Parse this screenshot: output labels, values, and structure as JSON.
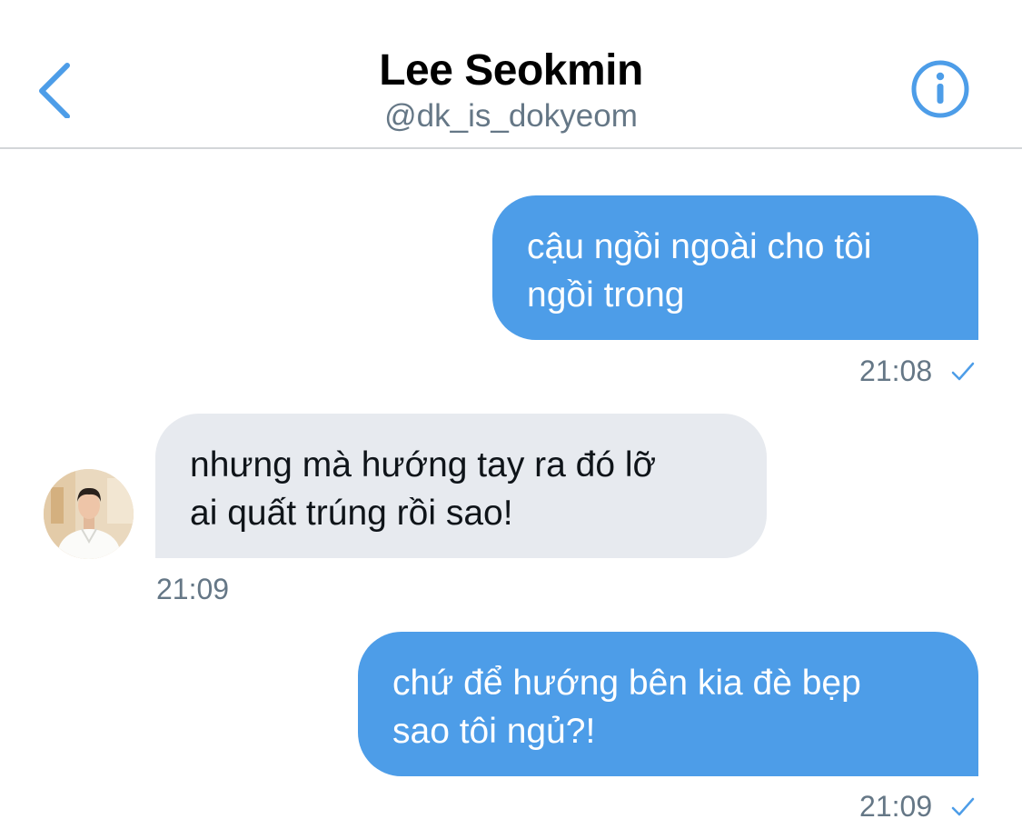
{
  "header": {
    "name": "Lee Seokmin",
    "handle": "@dk_is_dokyeom",
    "back_icon": "chevron-left-icon",
    "info_icon": "info-circle-icon",
    "accent_color": "#4d9de8"
  },
  "messages": [
    {
      "direction": "outgoing",
      "lines": [
        "cậu ngồi ngoài cho tôi",
        "ngồi trong"
      ],
      "time": "21:08",
      "status_icon": "check-icon"
    },
    {
      "direction": "incoming",
      "lines": [
        "nhưng mà hướng tay ra đó lỡ",
        "ai quất trúng rồi sao!"
      ],
      "time": "21:09",
      "avatar": "avatar-photo"
    },
    {
      "direction": "outgoing",
      "lines": [
        "chứ để hướng bên kia đè bẹp",
        "sao tôi ngủ?!"
      ],
      "time": "21:09",
      "status_icon": "check-icon"
    }
  ],
  "colors": {
    "outgoing_bubble": "#4d9de8",
    "incoming_bubble": "#e7eaef",
    "meta_text": "#657786",
    "divider": "#d3d6d9"
  }
}
